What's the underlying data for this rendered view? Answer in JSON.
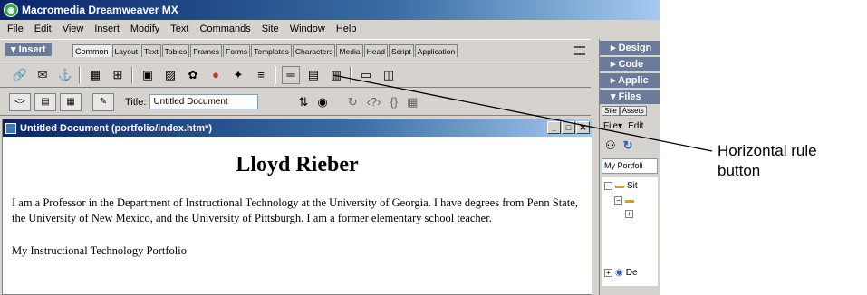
{
  "app": {
    "title": "Macromedia Dreamweaver MX"
  },
  "menu": [
    "File",
    "Edit",
    "View",
    "Insert",
    "Modify",
    "Text",
    "Commands",
    "Site",
    "Window",
    "Help"
  ],
  "insert_panel": {
    "label": "▾ Insert",
    "tabs": [
      "Common",
      "Layout",
      "Text",
      "Tables",
      "Frames",
      "Forms",
      "Templates",
      "Characters",
      "Media",
      "Head",
      "Script",
      "Application"
    ],
    "active_tab": "Common",
    "objects": [
      "hyperlink-icon",
      "email-link-icon",
      "named-anchor-icon",
      "table-icon",
      "draw-layer-icon",
      "image-icon",
      "image-placeholder-icon",
      "fireworks-html-icon",
      "flash-icon",
      "rollover-image-icon",
      "navigation-bar-icon",
      "horizontal-rule-icon",
      "date-icon",
      "tabular-data-icon",
      "comment-icon",
      "tag-chooser-icon"
    ]
  },
  "doc_toolbar": {
    "title_label": "Title:",
    "title_value": "Untitled Document"
  },
  "document": {
    "window_title": "Untitled Document (portfolio/index.htm*)",
    "heading": "Lloyd Rieber",
    "paragraph": "I am a Professor in the Department of Instructional Technology at the University of Georgia. I have degrees from Penn State, the University of New Mexico, and the University of Pittsburgh. I am a former elementary school teacher.",
    "paragraph2": "My Instructional Technology Portfolio"
  },
  "right_panel": {
    "headers": [
      "▸ Design",
      "▸ Code",
      "▸ Applic",
      "▾ Files"
    ],
    "subtabs": [
      "Site",
      "Assets"
    ],
    "menu": [
      "File▾",
      "Edit"
    ],
    "site_select": "My Portfoli",
    "tree": [
      "Sit",
      "",
      "De"
    ]
  },
  "callout": {
    "line1": "Horizontal rule",
    "line2": "button"
  }
}
